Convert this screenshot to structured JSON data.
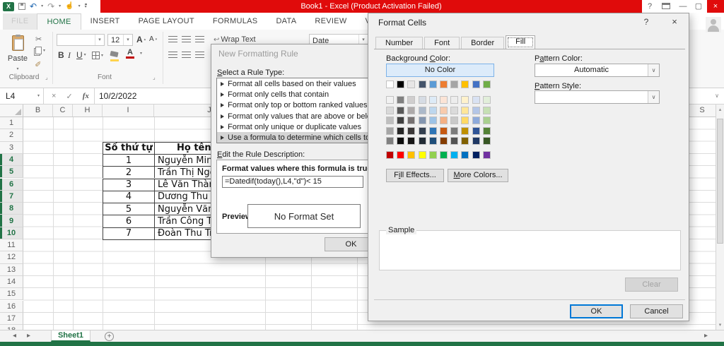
{
  "window": {
    "title": "Book1 - Excel (Product Activation Failed)",
    "help": "?",
    "minimize": "—",
    "maximize": "▢",
    "close": "×"
  },
  "ribbon_tabs": [
    {
      "label": "FILE",
      "state": "file"
    },
    {
      "label": "HOME",
      "state": "active"
    },
    {
      "label": "INSERT",
      "state": ""
    },
    {
      "label": "PAGE LAYOUT",
      "state": ""
    },
    {
      "label": "FORMULAS",
      "state": ""
    },
    {
      "label": "DATA",
      "state": ""
    },
    {
      "label": "REVIEW",
      "state": ""
    },
    {
      "label": "VIEW",
      "state": ""
    }
  ],
  "ribbon": {
    "paste": "Paste",
    "clipboard_group": "Clipboard",
    "font_group": "Font",
    "font_size": "12",
    "bold": "B",
    "italic": "I",
    "underline": "U",
    "grow_font": "A",
    "shrink_font": "A",
    "font_color_letter": "A",
    "wrap_text": "Wrap Text",
    "number_format": "Date"
  },
  "formula_bar": {
    "name_box": "L4",
    "cancel": "×",
    "enter": "✓",
    "fx": "fx",
    "value": "10/2/2022"
  },
  "sheet": {
    "columns": [
      "B",
      "C",
      "H",
      "I",
      "J"
    ],
    "right_column": "S",
    "row_count": 18,
    "highlight_rows": [
      4,
      10
    ],
    "active_tab": "Sheet1",
    "table": {
      "headers": [
        "Số thứ tự",
        "Họ tên"
      ],
      "rows": [
        [
          "1",
          "Nguyễn Minh"
        ],
        [
          "2",
          "Trần Thị Ngọ"
        ],
        [
          "3",
          "Lê Văn Thành"
        ],
        [
          "4",
          "Dương Thu H"
        ],
        [
          "5",
          "Nguyễn Văn"
        ],
        [
          "6",
          "Trần Công Th"
        ],
        [
          "7",
          "Đoàn Thu Tra"
        ]
      ]
    }
  },
  "nfr": {
    "title": "New Formatting Rule",
    "select_label": "Select a Rule Type:",
    "rules": [
      "Format all cells based on their values",
      "Format only cells that contain",
      "Format only top or bottom ranked values",
      "Format only values that are above or below average",
      "Format only unique or duplicate values",
      "Use a formula to determine which cells to format"
    ],
    "selected_rule": 5,
    "edit_label": "Edit the Rule Description:",
    "formula_label": "Format values where this formula is true:",
    "formula": "=Datedif(today(),L4,\"d\")< 15",
    "preview_label": "Preview:",
    "preview_value": "No Format Set",
    "ok": "OK"
  },
  "fc": {
    "title": "Format Cells",
    "help": "?",
    "close": "×",
    "tabs": [
      "Number",
      "Font",
      "Border",
      "Fill"
    ],
    "active_tab": "Fill",
    "background_label": "Background Color:",
    "no_color": "No Color",
    "palette": {
      "theme": [
        "#FFFFFF",
        "#000000",
        "#E7E6E6",
        "#44546A",
        "#5B9BD5",
        "#ED7D31",
        "#A5A5A5",
        "#FFC000",
        "#4472C4",
        "#70AD47"
      ],
      "tints": [
        [
          "#F2F2F2",
          "#808080",
          "#D0CECE",
          "#D6DCE4",
          "#DDEBF7",
          "#FCE4D6",
          "#EDEDED",
          "#FFF2CC",
          "#D9E2F3",
          "#E2EFDA"
        ],
        [
          "#D9D9D9",
          "#595959",
          "#AEAAAA",
          "#ACB9CA",
          "#BDD7EE",
          "#F8CBAD",
          "#DBDBDB",
          "#FFE699",
          "#B4C6E7",
          "#C6E0B4"
        ],
        [
          "#BFBFBF",
          "#404040",
          "#767171",
          "#8496B0",
          "#9DC3E6",
          "#F4B084",
          "#C9C9C9",
          "#FFD966",
          "#8EAADB",
          "#A9D08E"
        ],
        [
          "#A6A6A6",
          "#262626",
          "#3B3838",
          "#333F4F",
          "#2E75B6",
          "#C65911",
          "#7B7B7B",
          "#BF8F00",
          "#2F5496",
          "#548235"
        ],
        [
          "#808080",
          "#0D0D0D",
          "#181717",
          "#222B35",
          "#1F4E79",
          "#833C00",
          "#525252",
          "#806000",
          "#1F3864",
          "#375623"
        ]
      ],
      "standard": [
        "#C00000",
        "#FF0000",
        "#FFC000",
        "#FFFF00",
        "#92D050",
        "#00B050",
        "#00B0F0",
        "#0070C0",
        "#002060",
        "#7030A0"
      ]
    },
    "fill_effects": "Fill Effects...",
    "more_colors": "More Colors...",
    "pattern_color_label": "Pattern Color:",
    "pattern_color_value": "Automatic",
    "pattern_style_label": "Pattern Style:",
    "pattern_style_value": "",
    "sample_label": "Sample",
    "clear": "Clear",
    "ok": "OK",
    "cancel": "Cancel"
  },
  "colors": {
    "excel_green": "#217346",
    "title_red": "#E00B0B",
    "selection_gray": "#D4D4D4",
    "no_color_fill": "#DCEBFA",
    "no_color_border": "#7CB2E8",
    "focus_blue": "#0078D7"
  }
}
